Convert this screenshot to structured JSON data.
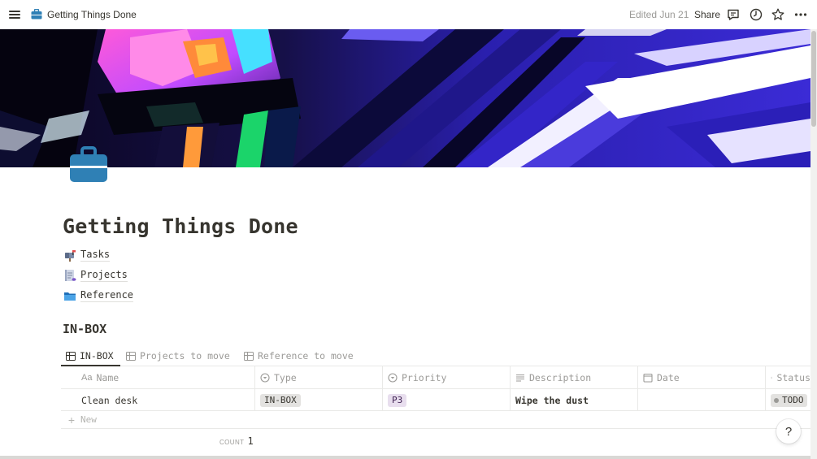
{
  "topbar": {
    "page_title": "Getting Things Done",
    "edited": "Edited Jun 21",
    "share_label": "Share",
    "icons": [
      "menu-icon",
      "briefcase-icon",
      "comment-icon",
      "clock-icon",
      "star-icon",
      "more-icon"
    ]
  },
  "page": {
    "title": "Getting Things Done",
    "icon": "briefcase-icon",
    "icon_color": "#2f80b5",
    "links": [
      {
        "label": "Tasks",
        "icon": "mailbox-icon"
      },
      {
        "label": "Projects",
        "icon": "notebook-icon"
      },
      {
        "label": "Reference",
        "icon": "folder-icon"
      }
    ]
  },
  "inbox": {
    "heading": "IN-BOX",
    "tabs": [
      {
        "label": "IN-BOX",
        "active": true
      },
      {
        "label": "Projects to move",
        "active": false
      },
      {
        "label": "Reference to move",
        "active": false
      }
    ],
    "columns": [
      {
        "label": "Name",
        "icon": "Aa"
      },
      {
        "label": "Type",
        "icon": "select-icon"
      },
      {
        "label": "Priority",
        "icon": "select-icon"
      },
      {
        "label": "Description",
        "icon": "text-icon"
      },
      {
        "label": "Date",
        "icon": "calendar-icon"
      },
      {
        "label": "Status",
        "icon": "status-icon"
      }
    ],
    "rows": [
      {
        "name": "Clean desk",
        "type": "IN-BOX",
        "priority": "P3",
        "description": "Wipe the dust",
        "date": "",
        "status": "TODO"
      }
    ],
    "type_tag_color": "#e3e2e0",
    "priority_tag_color": "#e8deee",
    "status_tag_color": "#e3e2e0",
    "new_label": "New",
    "count_label": "COUNT",
    "count_value": "1"
  },
  "help_label": "?"
}
